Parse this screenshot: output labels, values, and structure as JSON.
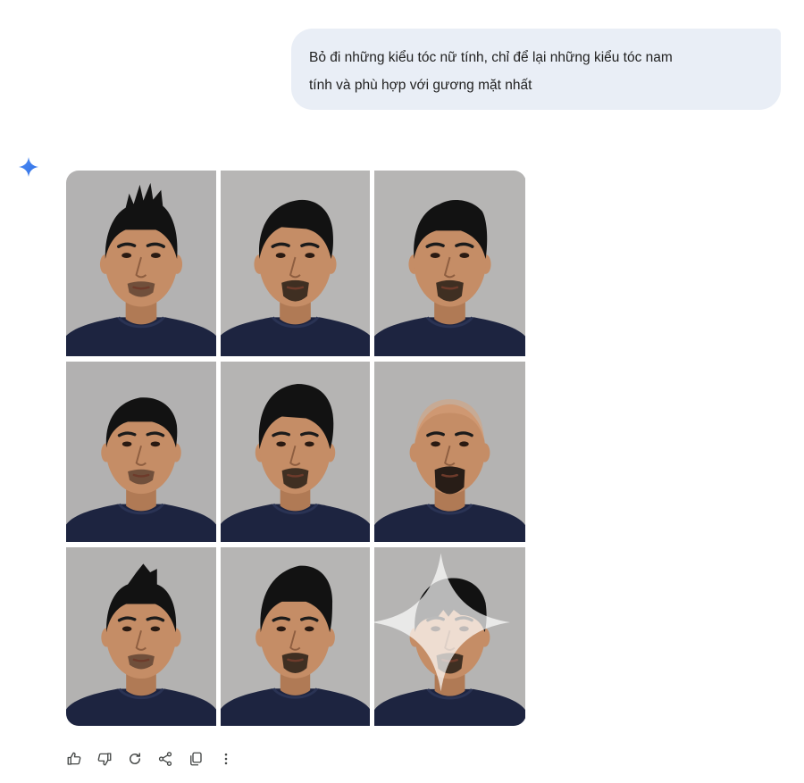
{
  "conversation": {
    "user_message": {
      "line1": "Bỏ đi những kiểu tóc nữ tính, chỉ để lại những kiểu tóc nam",
      "line2": "tính và phù hợp với gương mặt nhất"
    },
    "assistant_icon": "gemini-spark-icon"
  },
  "image_grid": {
    "rows": 3,
    "cols": 3,
    "tiles": [
      {
        "hairstyle": "spiky-top",
        "beard": "stubble",
        "background": "#b3b2b2"
      },
      {
        "hairstyle": "swept-pompadour",
        "beard": "goatee",
        "background": "#b7b6b5"
      },
      {
        "hairstyle": "textured-crop",
        "beard": "goatee",
        "background": "#b6b5b4"
      },
      {
        "hairstyle": "short-crop",
        "beard": "stubble",
        "background": "#b2b1b1"
      },
      {
        "hairstyle": "voluminous-quiff",
        "beard": "goatee",
        "background": "#b5b4b3"
      },
      {
        "hairstyle": "shaved-bald",
        "beard": "full-goatee",
        "background": "#b4b3b2"
      },
      {
        "hairstyle": "faux-hawk",
        "beard": "stubble",
        "background": "#b3b2b1"
      },
      {
        "hairstyle": "high-pompadour",
        "beard": "goatee",
        "background": "#b6b5b4"
      },
      {
        "hairstyle": "messy-fringe",
        "beard": "goatee",
        "background": "#b5b4b3"
      }
    ],
    "watermark_icon": "sparkle-watermark-icon"
  },
  "action_bar": {
    "icons": [
      "thumbs-up-icon",
      "thumbs-down-icon",
      "regenerate-icon",
      "share-icon",
      "copy-icon",
      "more-options-icon"
    ]
  },
  "colors": {
    "bubble_bg": "#e9eef6",
    "accent": "#4285f4",
    "shirt": "#1d2440",
    "skin": "#c58d66",
    "hair": "#121212",
    "icon": "#444746"
  }
}
